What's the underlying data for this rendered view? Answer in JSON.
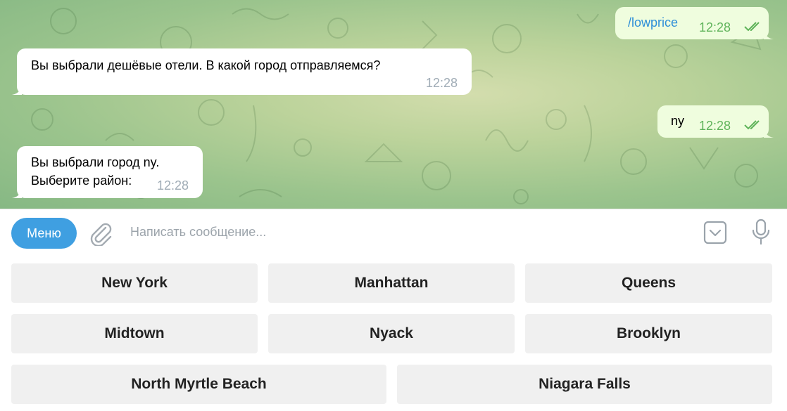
{
  "messages": [
    {
      "direction": "out",
      "text": "/lowprice",
      "time": "12:28"
    },
    {
      "direction": "in",
      "text": "Вы выбрали дешёвые отели. В какой город отправляемся?",
      "time": "12:28"
    },
    {
      "direction": "out",
      "text": "ny",
      "time": "12:28"
    },
    {
      "direction": "in",
      "lines": [
        "Вы выбрали город ny.",
        "Выберите район:"
      ],
      "time": "12:28"
    }
  ],
  "composer": {
    "menu_label": "Меню",
    "placeholder": "Написать сообщение..."
  },
  "keyboard": {
    "rows": [
      [
        "New York",
        "Manhattan",
        "Queens"
      ],
      [
        "Midtown",
        "Nyack",
        "Brooklyn"
      ],
      [
        "North Myrtle Beach",
        "Niagara Falls"
      ]
    ]
  },
  "colors": {
    "accent": "#3f9fe1",
    "out_bubble": "#effdde",
    "read_check": "#5fb35a",
    "link": "#2e8fd8"
  },
  "icons": [
    "double-check-icon",
    "paperclip-icon",
    "bot-keyboard-icon",
    "microphone-icon"
  ]
}
